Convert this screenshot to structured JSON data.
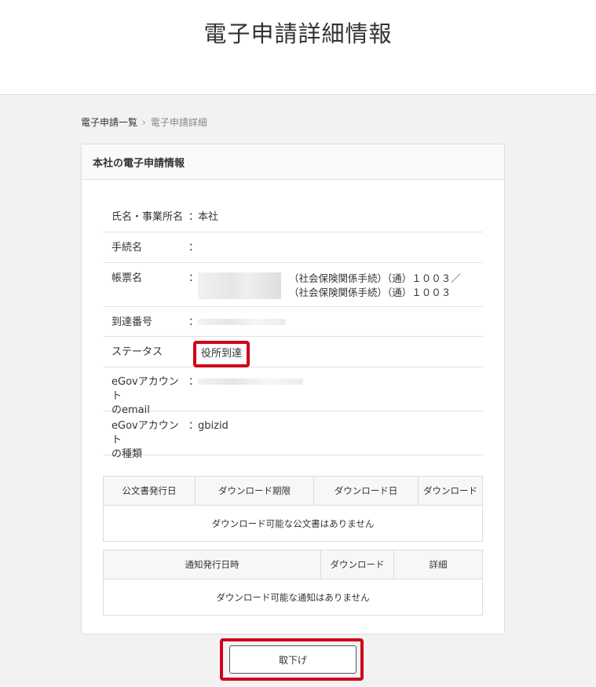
{
  "page": {
    "title": "電子申請詳細情報"
  },
  "breadcrumb": {
    "items": [
      "電子申請一覧",
      "電子申請詳細"
    ],
    "separator": "›"
  },
  "card": {
    "title": "本社の電子申請情報",
    "rows": [
      {
        "label": "氏名・事業所名",
        "value": "本社"
      },
      {
        "label": "手続名",
        "value": ""
      },
      {
        "label": "帳票名",
        "value_line1": "（社会保険関係手続）（通）１００３／",
        "value_line2": "（社会保険関係手続）（通）１００３"
      },
      {
        "label": "到達番号",
        "value": ""
      },
      {
        "label": "ステータス",
        "value": "役所到達"
      },
      {
        "label_line1": "eGovアカウント",
        "label_line2": "のemail",
        "value": ""
      },
      {
        "label_line1": "eGovアカウント",
        "label_line2": "の種類",
        "value": "gbizid"
      }
    ],
    "colon": "："
  },
  "documents_table": {
    "headers": [
      "公文書発行日",
      "ダウンロード期限",
      "ダウンロード日",
      "ダウンロード"
    ],
    "empty_message": "ダウンロード可能な公文書はありません"
  },
  "notices_table": {
    "headers": [
      "通知発行日時",
      "ダウンロード",
      "詳細"
    ],
    "empty_message": "ダウンロード可能な通知はありません"
  },
  "actions": {
    "withdraw_label": "取下げ"
  },
  "colors": {
    "accent_highlight": "#d0021b"
  }
}
